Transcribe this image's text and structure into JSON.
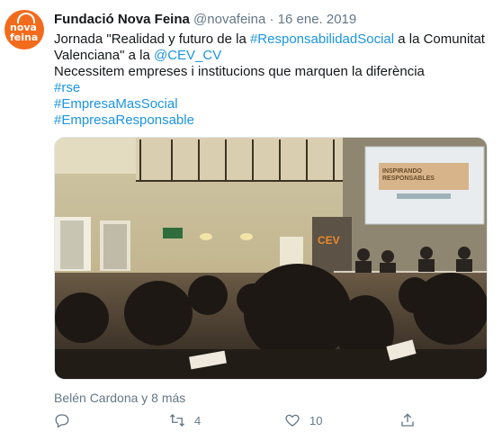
{
  "author": {
    "name": "Fundació Nova Feina",
    "handle": "@novafeina",
    "separator": "·",
    "date": "16 ene. 2019",
    "avatar_logo_lines": [
      "nova",
      "feina"
    ]
  },
  "tweet": {
    "line1_pre": "Jornada \"Realidad y futuro de la ",
    "line1_hashtag": "#ResponsabilidadSocial",
    "line1_post": " a la Comunitat",
    "line2_pre": "Valenciana\" a la ",
    "line2_mention": "@CEV_CV",
    "line3": "Necessitem empreses i institucions que marquen la diferència",
    "hashtags": [
      "#rse",
      "#EmpresaMasSocial",
      "#EmpresaResponsable"
    ]
  },
  "photo": {
    "sign_text": "CEV",
    "screen_title": "INSPIRANDO RESPONSABLES"
  },
  "likes_summary": "Belén Cardona y 8 más",
  "actions": {
    "reply_count": "",
    "retweet_count": "4",
    "like_count": "10",
    "share_count": ""
  },
  "colors": {
    "link": "#1b95e0",
    "muted": "#657786",
    "brand_orange": "#f26b1d"
  }
}
